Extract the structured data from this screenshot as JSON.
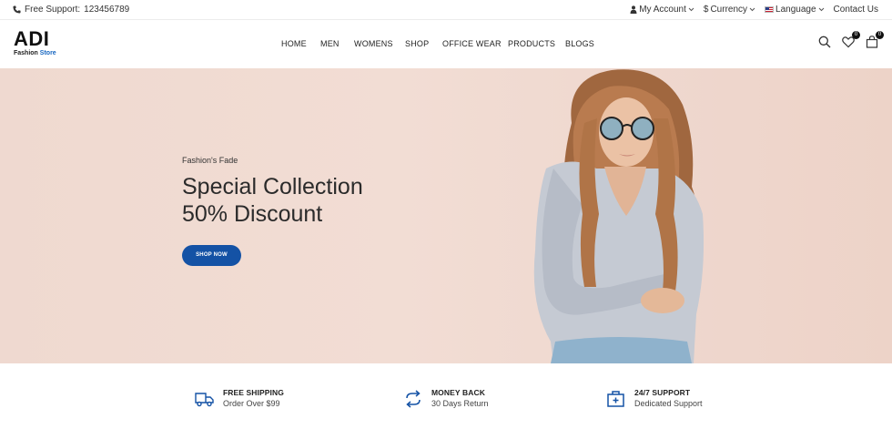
{
  "topbar": {
    "support_prefix": "Free Support:",
    "support_phone": "123456789",
    "account": "My Account",
    "currency": "Currency",
    "currency_symbol": "$",
    "language": "Language",
    "contact": "Contact Us"
  },
  "logo": {
    "brand": "ADI",
    "tagline_a": "Fashion",
    "tagline_b": "Store"
  },
  "nav": {
    "items": [
      "HOME",
      "MEN",
      "WOMENS",
      "SHOP",
      "OFFICE WEAR",
      "PRODUCTS",
      "BLOGS"
    ]
  },
  "header": {
    "wishlist_count": "0",
    "cart_count": "0"
  },
  "hero": {
    "kicker": "Fashion's Fade",
    "title_line1": "Special Collection",
    "title_line2": "50% Discount",
    "cta": "SHOP NOW"
  },
  "features": [
    {
      "title": "FREE SHIPPING",
      "subtitle": "Order Over $99",
      "icon": "truck-icon"
    },
    {
      "title": "MONEY BACK",
      "subtitle": "30 Days Return",
      "icon": "return-arrows-icon"
    },
    {
      "title": "24/7 SUPPORT",
      "subtitle": "Dedicated Support",
      "icon": "support-box-icon"
    }
  ],
  "colors": {
    "accent": "#1452a5",
    "hero_bg": "#f0dad1"
  }
}
